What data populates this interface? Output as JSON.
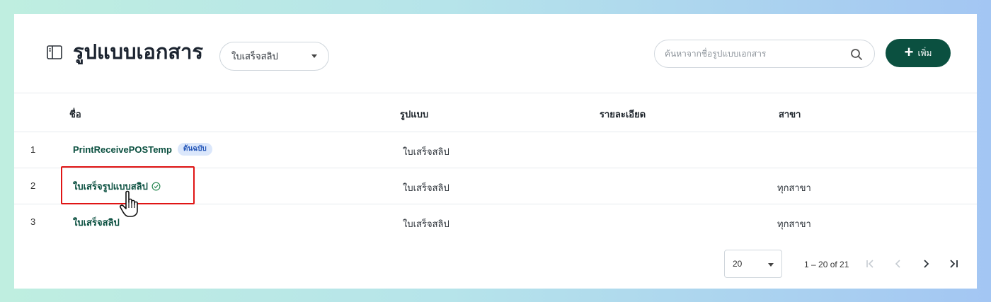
{
  "header": {
    "title": "รูปแบบเอกสาร",
    "type_filter": "ใบเสร็จสลิป",
    "search_placeholder": "ค้นหาจากชื่อรูปแบบเอกสาร",
    "add_label": "เพิ่ม"
  },
  "table": {
    "columns": [
      "ชื่อ",
      "รูปแบบ",
      "รายละเอียด",
      "สาขา"
    ],
    "rows": [
      {
        "num": "1",
        "name": "PrintReceivePOSTemp",
        "badge": "ต้นฉบับ",
        "format": "ใบเสร็จสลิป",
        "detail": "",
        "branch": ""
      },
      {
        "num": "2",
        "name": "ใบเสร็จรูปแบบสลิป",
        "default": true,
        "format": "ใบเสร็จสลิป",
        "detail": "",
        "branch": "ทุกสาขา"
      },
      {
        "num": "3",
        "name": "ใบเสร็จสลิป",
        "format": "ใบเสร็จสลิป",
        "detail": "",
        "branch": "ทุกสาขา"
      }
    ]
  },
  "pagination": {
    "per_page": "20",
    "range": "1 – 20 of 21"
  },
  "colors": {
    "primary": "#0b5040",
    "highlight": "#e01515",
    "badge_bg": "#dbe7fb",
    "badge_text": "#2456b8"
  }
}
